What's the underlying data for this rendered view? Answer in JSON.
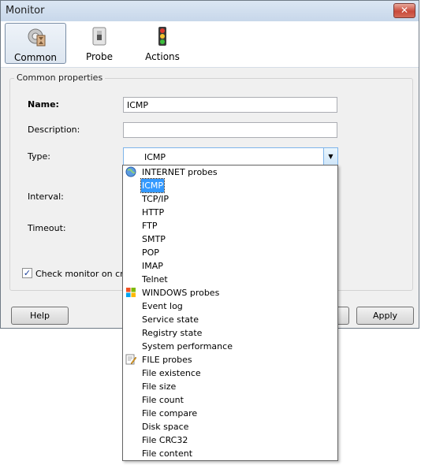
{
  "window": {
    "title": "Monitor",
    "close": "✕"
  },
  "toolbar": {
    "items": [
      {
        "label": "Common"
      },
      {
        "label": "Probe"
      },
      {
        "label": "Actions"
      }
    ]
  },
  "group": {
    "title": "Common properties"
  },
  "form": {
    "name_label": "Name:",
    "name_value": "ICMP",
    "description_label": "Description:",
    "description_value": "",
    "type_label": "Type:",
    "type_value": "ICMP",
    "interval_label": "Interval:",
    "timeout_label": "Timeout:",
    "check_label": "Check monitor on creat",
    "check_mark": "✓"
  },
  "buttons": {
    "help": "Help",
    "apply": "Apply"
  },
  "dropdown": {
    "items": [
      {
        "label": "INTERNET probes",
        "icon": "globe-icon"
      },
      {
        "label": "ICMP"
      },
      {
        "label": "TCP/IP"
      },
      {
        "label": "HTTP"
      },
      {
        "label": "FTP"
      },
      {
        "label": "SMTP"
      },
      {
        "label": "POP"
      },
      {
        "label": "IMAP"
      },
      {
        "label": "Telnet"
      },
      {
        "label": "WINDOWS probes",
        "icon": "windows-logo-icon"
      },
      {
        "label": "Event log"
      },
      {
        "label": "Service state"
      },
      {
        "label": "Registry state"
      },
      {
        "label": "System performance"
      },
      {
        "label": "FILE probes",
        "icon": "file-edit-icon"
      },
      {
        "label": "File existence"
      },
      {
        "label": "File size"
      },
      {
        "label": "File count"
      },
      {
        "label": "File compare"
      },
      {
        "label": "Disk space"
      },
      {
        "label": "File CRC32"
      },
      {
        "label": "File content"
      }
    ],
    "selected_label": "ICMP"
  },
  "colors": {
    "selection": "#3399ff",
    "title_bar": "#c7d7ea"
  }
}
